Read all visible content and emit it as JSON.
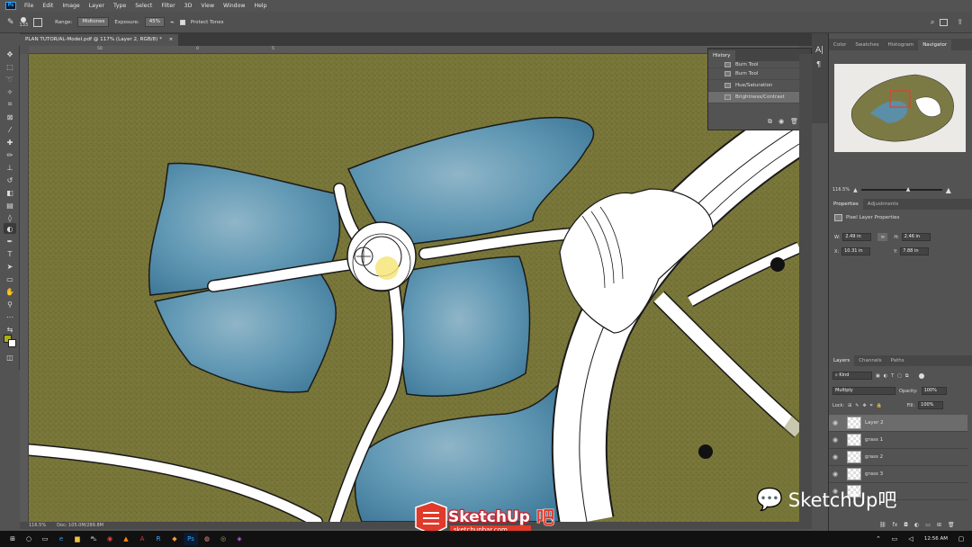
{
  "app": {
    "logo": "Ps",
    "menus": [
      "File",
      "Edit",
      "Image",
      "Layer",
      "Type",
      "Select",
      "Filter",
      "3D",
      "View",
      "Window",
      "Help"
    ]
  },
  "options": {
    "brush_size": "133",
    "range_label": "Range:",
    "range_value": "Midtones",
    "exposure_label": "Exposure:",
    "exposure_value": "45%",
    "protect_tones": "Protect Tones"
  },
  "document": {
    "tab_title": "PLAN TUTOR/AL-Model.pdf @ 117% (Layer 2, RGB/8) *",
    "status_zoom": "116.5%",
    "status_doc": "Doc: 105.0M/289.8M",
    "ruler_marks": [
      "50",
      "0",
      "5"
    ]
  },
  "history": {
    "title": "History",
    "items": [
      {
        "label": "Burn Tool"
      },
      {
        "label": "Burn Tool"
      },
      {
        "label": "Hue/Saturation"
      },
      {
        "label": "Brightness/Contrast"
      }
    ]
  },
  "right_panel": {
    "top_tabs": [
      "Color",
      "Swatches",
      "Histogram",
      "Navigator"
    ],
    "nav_zoom": "116.5%",
    "prop_tabs": [
      "Properties",
      "Adjustments"
    ],
    "prop_title": "Pixel Layer Properties",
    "w_label": "W:",
    "w_value": "2.49 in",
    "h_label": "H:",
    "h_value": "2.46 in",
    "x_label": "X:",
    "x_value": "10.31 in",
    "y_label": "Y:",
    "y_value": "7.88 in",
    "layer_tabs": [
      "Layers",
      "Channels",
      "Paths"
    ],
    "kind": "Kind",
    "blend_mode": "Multiply",
    "opacity_label": "Opacity:",
    "opacity_value": "100%",
    "lock_label": "Lock:",
    "fill_label": "Fill:",
    "fill_value": "100%",
    "layers": [
      {
        "name": "Layer 2"
      },
      {
        "name": "grass 1"
      },
      {
        "name": "grass 2"
      },
      {
        "name": "grass 3"
      }
    ]
  },
  "taskbar": {
    "time": "12:56 AM"
  },
  "watermark": {
    "brand": "SketchUp",
    "brand_char": "吧",
    "url": "sketchupbar.com",
    "wechat": "SketchUp吧"
  },
  "colors": {
    "water": "#4d8aa8",
    "grass": "#7a7a3c",
    "path": "#ffffff"
  }
}
